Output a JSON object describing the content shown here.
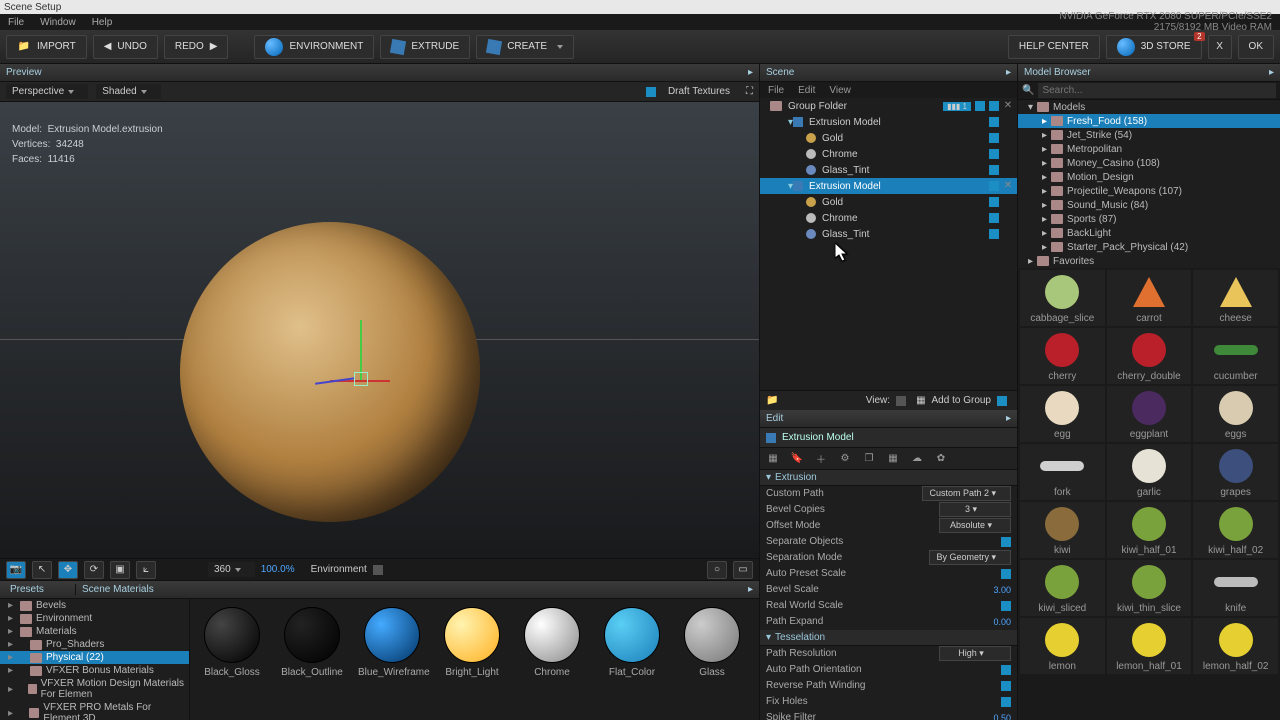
{
  "window": {
    "title": "Scene Setup"
  },
  "menubar": {
    "file": "File",
    "window": "Window",
    "help": "Help",
    "gpu_line1": "NVIDIA GeForce RTX 2080 SUPER/PCIe/SSE2",
    "gpu_line2": "2175/8192 MB Video RAM"
  },
  "toolbar": {
    "import": "IMPORT",
    "undo": "UNDO",
    "redo": "REDO",
    "environment": "ENVIRONMENT",
    "extrude": "EXTRUDE",
    "create": "CREATE",
    "help_center": "HELP CENTER",
    "store": "3D STORE",
    "store_badge": "2",
    "ok": "OK",
    "close": "X"
  },
  "preview": {
    "title": "Preview",
    "view_mode": "Perspective",
    "shade_mode": "Shaded",
    "draft_textures": "Draft Textures",
    "model_label": "Model:",
    "model_value": "Extrusion Model.extrusion",
    "vertices_label": "Vertices:",
    "vertices_value": "34248",
    "faces_label": "Faces:",
    "faces_value": "11416"
  },
  "viewbar": {
    "fov": "360",
    "zoom": "100.0%",
    "env": "Environment"
  },
  "presets": {
    "title_presets": "Presets",
    "title_scene_materials": "Scene Materials",
    "tree": [
      {
        "label": "Bevels"
      },
      {
        "label": "Environment"
      },
      {
        "label": "Materials"
      },
      {
        "label": "Pro_Shaders",
        "indent": 1
      },
      {
        "label": "Physical (22)",
        "indent": 1,
        "selected": true
      },
      {
        "label": "VFXER Bonus Materials",
        "indent": 1
      },
      {
        "label": "VFXER Motion Design Materials For Elemen",
        "indent": 1
      },
      {
        "label": "VFXER PRO Metals For Element 3D",
        "indent": 1
      }
    ],
    "mats": [
      {
        "name": "Black_Gloss",
        "bg": "radial-gradient(circle at 30% 30%,#444,#000)"
      },
      {
        "name": "Black_Outline",
        "bg": "radial-gradient(circle at 30% 30%,#222,#000)"
      },
      {
        "name": "Blue_Wireframe",
        "bg": "radial-gradient(circle at 30% 30%,#4af,#036)"
      },
      {
        "name": "Bright_Light",
        "bg": "radial-gradient(circle at 30% 30%,#fff3b0,#ffb020)"
      },
      {
        "name": "Chrome",
        "bg": "radial-gradient(circle at 30% 30%,#fff,#888)"
      },
      {
        "name": "Flat_Color",
        "bg": "radial-gradient(circle at 30% 30%,#5acef4,#1b7fb9)"
      },
      {
        "name": "Glass",
        "bg": "radial-gradient(circle at 30% 30%,#ccc,#777)"
      }
    ]
  },
  "scene": {
    "title": "Scene",
    "menu": {
      "file": "File",
      "edit": "Edit",
      "view": "View"
    },
    "tree": [
      {
        "type": "folder",
        "label": "Group Folder",
        "depth": 0
      },
      {
        "type": "obj",
        "label": "Extrusion Model",
        "depth": 1
      },
      {
        "type": "mat",
        "label": "Gold",
        "depth": 2,
        "color": "#c9a14a"
      },
      {
        "type": "mat",
        "label": "Chrome",
        "depth": 2,
        "color": "#bbb"
      },
      {
        "type": "mat",
        "label": "Glass_Tint",
        "depth": 2,
        "color": "#6a8abf"
      },
      {
        "type": "obj",
        "label": "Extrusion Model",
        "depth": 1,
        "selected": true,
        "closable": true
      },
      {
        "type": "mat",
        "label": "Gold",
        "depth": 2,
        "color": "#c9a14a"
      },
      {
        "type": "mat",
        "label": "Chrome",
        "depth": 2,
        "color": "#bbb"
      },
      {
        "type": "mat",
        "label": "Glass_Tint",
        "depth": 2,
        "color": "#6a8abf"
      }
    ],
    "bottom": {
      "view": "View:",
      "add_group": "Add to Group"
    }
  },
  "edit": {
    "title": "Edit",
    "header": "Extrusion Model",
    "group_extrusion": "Extrusion",
    "props_extrusion": [
      {
        "label": "Custom Path",
        "type": "select",
        "value": "Custom Path 2"
      },
      {
        "label": "Bevel Copies",
        "type": "select",
        "value": "3"
      },
      {
        "label": "Offset Mode",
        "type": "select",
        "value": "Absolute"
      },
      {
        "label": "Separate Objects",
        "type": "check"
      },
      {
        "label": "Separation Mode",
        "type": "select",
        "value": "By Geometry"
      },
      {
        "label": "Auto Preset Scale",
        "type": "check"
      },
      {
        "label": "Bevel Scale",
        "type": "num",
        "value": "3.00"
      },
      {
        "label": "Real World Scale",
        "type": "check"
      },
      {
        "label": "Path Expand",
        "type": "num",
        "value": "0.00"
      }
    ],
    "group_tess": "Tesselation",
    "props_tess": [
      {
        "label": "Path Resolution",
        "type": "select",
        "value": "High"
      },
      {
        "label": "Auto Path Orientation",
        "type": "check"
      },
      {
        "label": "Reverse Path Winding",
        "type": "check"
      },
      {
        "label": "Fix Holes",
        "type": "check"
      },
      {
        "label": "Spike Filter",
        "type": "num",
        "value": "0.50"
      }
    ]
  },
  "browser": {
    "title": "Model Browser",
    "search_placeholder": "Search...",
    "tree": [
      {
        "label": "Models",
        "depth": 0,
        "open": true
      },
      {
        "label": "Fresh_Food (158)",
        "depth": 1,
        "selected": true
      },
      {
        "label": "Jet_Strike (54)",
        "depth": 1
      },
      {
        "label": "Metropolitan",
        "depth": 1
      },
      {
        "label": "Money_Casino (108)",
        "depth": 1
      },
      {
        "label": "Motion_Design",
        "depth": 1
      },
      {
        "label": "Projectile_Weapons (107)",
        "depth": 1
      },
      {
        "label": "Sound_Music (84)",
        "depth": 1
      },
      {
        "label": "Sports (87)",
        "depth": 1
      },
      {
        "label": "BackLight",
        "depth": 1
      },
      {
        "label": "Starter_Pack_Physical (42)",
        "depth": 1
      },
      {
        "label": "Favorites",
        "depth": 0
      }
    ],
    "models": [
      {
        "label": "cabbage_slice",
        "bg": "#a9c77a",
        "shape": "circle"
      },
      {
        "label": "carrot",
        "bg": "#e07030",
        "shape": "tri"
      },
      {
        "label": "cheese",
        "bg": "#e8c45b",
        "shape": "tri"
      },
      {
        "label": "cherry",
        "bg": "#b9202a",
        "shape": "circle"
      },
      {
        "label": "cherry_double",
        "bg": "#b9202a",
        "shape": "circle"
      },
      {
        "label": "cucumber",
        "bg": "#3f8a3a",
        "shape": "bar"
      },
      {
        "label": "egg",
        "bg": "#e8d9c0",
        "shape": "circle"
      },
      {
        "label": "eggplant",
        "bg": "#4b2a60",
        "shape": "circle"
      },
      {
        "label": "eggs",
        "bg": "#d8cbb0",
        "shape": "circle"
      },
      {
        "label": "fork",
        "bg": "#cfcfcf",
        "shape": "bar"
      },
      {
        "label": "garlic",
        "bg": "#e6e2d6",
        "shape": "circle"
      },
      {
        "label": "grapes",
        "bg": "#3c4f7d",
        "shape": "circle"
      },
      {
        "label": "kiwi",
        "bg": "#8a6b3b",
        "shape": "circle"
      },
      {
        "label": "kiwi_half_01",
        "bg": "#7aa23c",
        "shape": "circle"
      },
      {
        "label": "kiwi_half_02",
        "bg": "#7aa23c",
        "shape": "circle"
      },
      {
        "label": "kiwi_sliced",
        "bg": "#7aa23c",
        "shape": "circle"
      },
      {
        "label": "kiwi_thin_slice",
        "bg": "#7aa23c",
        "shape": "circle"
      },
      {
        "label": "knife",
        "bg": "#bcbcbc",
        "shape": "bar"
      },
      {
        "label": "lemon",
        "bg": "#e6cf30",
        "shape": "circle"
      },
      {
        "label": "lemon_half_01",
        "bg": "#e6cf30",
        "shape": "circle"
      },
      {
        "label": "lemon_half_02",
        "bg": "#e6cf30",
        "shape": "circle"
      }
    ]
  }
}
